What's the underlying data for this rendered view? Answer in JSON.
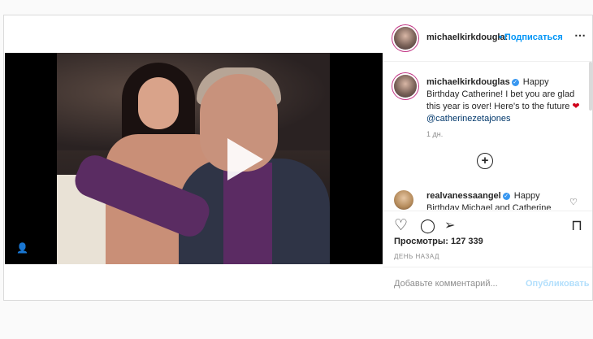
{
  "header": {
    "username": "michaelkirkdougla:",
    "subscribe_label": "• Подписаться",
    "more_icon": "⋯"
  },
  "caption": {
    "username": "michaelkirkdouglas",
    "text": "Happy Birthday Catherine! I bet you are glad this year is over! Here's to the future",
    "heart": "❤",
    "mention": "@catherinezetajones",
    "time": "1 дн."
  },
  "load_more_icon": "+",
  "comment": {
    "username": "realvanessaangel",
    "text": "Happy Birthday Michael and Catherine 🎂",
    "like_icon": "♡"
  },
  "actions": {
    "like_icon": "♡",
    "comment_icon": "◯",
    "share_icon": "➢",
    "save_icon": "⊓"
  },
  "views": "Просмотры: 127 339",
  "date_ago": "ДЕНЬ НАЗАД",
  "add_comment": {
    "placeholder": "Добавьте комментарий...",
    "post_label": "Опубликовать"
  },
  "media": {
    "user_tag_icon": "👤"
  }
}
